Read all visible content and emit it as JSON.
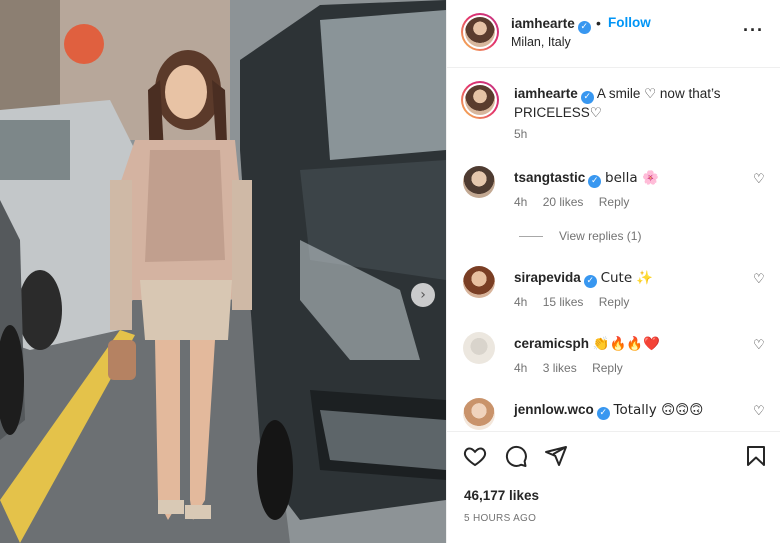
{
  "post": {
    "username": "iamhearte",
    "follow_label": "Follow",
    "separator": "•",
    "location": "Milan, Italy",
    "more_icon": "more-horizontal-icon",
    "verified_icon": "verified-badge-icon"
  },
  "caption": {
    "username": "iamhearte",
    "text": "A smile ♡ now that’s PRICELESS♡",
    "time": "5h"
  },
  "comments": [
    {
      "username": "tsangtastic",
      "text": "bella 🌸",
      "time": "4h",
      "likes": "20 likes",
      "reply": "Reply"
    },
    {
      "username": "sirapevida",
      "text": "Cute ✨",
      "time": "4h",
      "likes": "15 likes",
      "reply": "Reply"
    },
    {
      "username": "ceramicsph",
      "text": "👏🔥🔥❤️",
      "time": "4h",
      "likes": "3 likes",
      "reply": "Reply"
    },
    {
      "username": "jennlow.wco",
      "text": "Totally 🙃🙃🙃",
      "time": "",
      "likes": "",
      "reply": ""
    }
  ],
  "view_replies": "View replies (1)",
  "actions": {
    "like_icon": "heart-icon",
    "comment_icon": "comment-icon",
    "share_icon": "send-icon",
    "save_icon": "bookmark-icon"
  },
  "likes_count": "46,177 likes",
  "posted_ago": "5 HOURS AGO",
  "colors": {
    "accent": "#0095f6",
    "verified": "#3897f0",
    "muted": "#737373"
  }
}
